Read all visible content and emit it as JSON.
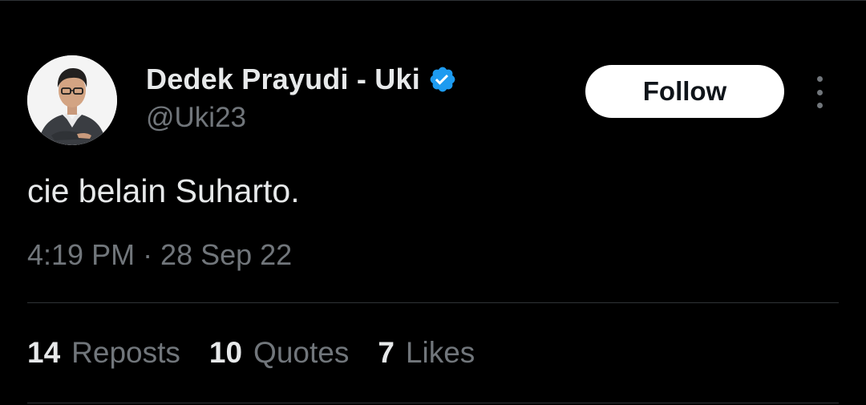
{
  "user": {
    "display_name": "Dedek Prayudi - Uki",
    "handle": "@Uki23",
    "verified": true,
    "verified_color": "#1d9bf0"
  },
  "actions": {
    "follow_label": "Follow",
    "more_icon": "more-vertical-icon"
  },
  "tweet": {
    "text": "cie belain Suharto.",
    "timestamp": "4:19 PM · 28 Sep 22"
  },
  "stats": [
    {
      "count": "14",
      "label": "Reposts"
    },
    {
      "count": "10",
      "label": "Quotes"
    },
    {
      "count": "7",
      "label": "Likes"
    }
  ],
  "colors": {
    "background": "#000000",
    "primary_text": "#e7e9ea",
    "secondary_text": "#71767b",
    "divider": "#2f3336",
    "follow_bg": "#ffffff",
    "follow_text": "#0f1419"
  }
}
